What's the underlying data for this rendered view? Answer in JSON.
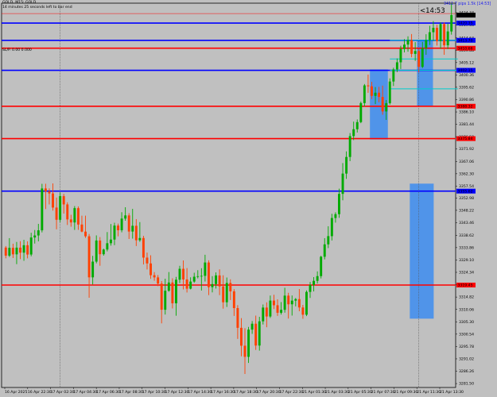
{
  "header": {
    "symbol_line": "GOLD, M15: GOLD",
    "info_line": "14 minutes 25 seconds left to bar end",
    "subinfo_line": "SL/P. 0.00 0.000"
  },
  "chart_data": {
    "type": "candlestick",
    "symbol": "GOLD",
    "timeframe": "M15",
    "ylim": [
      3280.0,
      3428.0
    ],
    "y_ticks": [
      3424.34,
      3419.58,
      3414.64,
      3409.88,
      3405.12,
      3400.36,
      3395.62,
      3390.86,
      3386.1,
      3381.44,
      3376.58,
      3371.92,
      3367.06,
      3362.3,
      3357.54,
      3352.98,
      3348.22,
      3343.46,
      3338.62,
      3333.86,
      3329.1,
      3324.34,
      3319.68,
      3314.82,
      3310.06,
      3305.3,
      3300.54,
      3295.78,
      3291.02,
      3286.26,
      3281.5
    ],
    "x_ticks": [
      "16 Apr 2025",
      "16 Apr 22:30",
      "17 Apr 02:30",
      "17 Apr 04:30",
      "17 Apr 06:30",
      "17 Apr 08:30",
      "17 Apr 10:30",
      "17 Apr 12:30",
      "17 Apr 14:30",
      "17 Apr 16:30",
      "17 Apr 18:30",
      "17 Apr 20:30",
      "17 Apr 22:30",
      "21 Apr 01:30",
      "21 Apr 03:30",
      "21 Apr 05:30",
      "21 Apr 07:30",
      "21 Apr 09:30",
      "21 Apr 11:30",
      "21 Apr 13:30"
    ],
    "session_separators": [
      "16 Apr 22:30",
      "21 Apr 01:00"
    ],
    "current_price": 3423.4,
    "bar_countdown": "<14:53",
    "chart_label": "3411.7 pips 1.5k [14:53]",
    "blue_levels": [
      3420.35,
      3413.7,
      3402.15,
      3355.62
    ],
    "red_levels": [
      3410.66,
      3388.32,
      3375.84,
      3319.45
    ],
    "candles_ohlc": [
      [
        3333.88,
        3334.46,
        3329.73,
        3330.77
      ],
      [
        3330.77,
        3337.51,
        3330.22,
        3333.78
      ],
      [
        3333.78,
        3335.37,
        3329.86,
        3331.27
      ],
      [
        3331.27,
        3336.05,
        3327.5,
        3333.85
      ],
      [
        3333.85,
        3336.34,
        3329.42,
        3331.92
      ],
      [
        3331.92,
        3336.87,
        3328.77,
        3334.78
      ],
      [
        3334.78,
        3336.29,
        3329.72,
        3331.2
      ],
      [
        3331.2,
        3339.59,
        3330.51,
        3337.76
      ],
      [
        3337.76,
        3340.65,
        3335.42,
        3338.54
      ],
      [
        3338.54,
        3343.01,
        3336.28,
        3340.52
      ],
      [
        3340.52,
        3358.43,
        3339.72,
        3356.64
      ],
      [
        3356.64,
        3358.45,
        3348.71,
        3355.51
      ],
      [
        3355.51,
        3356.67,
        3350.47,
        3354.72
      ],
      [
        3354.72,
        3358.58,
        3348.1,
        3349.29
      ],
      [
        3349.29,
        3353.14,
        3340.91,
        3344.58
      ],
      [
        3344.58,
        3355.07,
        3343.68,
        3353.68
      ],
      [
        3353.68,
        3354.54,
        3346.96,
        3350.5
      ],
      [
        3350.5,
        3351.33,
        3342.58,
        3344.72
      ],
      [
        3344.72,
        3346.51,
        3341.92,
        3343.55
      ],
      [
        3343.55,
        3349.86,
        3340.68,
        3349.06
      ],
      [
        3349.06,
        3349.73,
        3340.71,
        3342.75
      ],
      [
        3342.75,
        3346.17,
        3339.77,
        3340.02
      ],
      [
        3340.02,
        3346.16,
        3337.62,
        3338.23
      ],
      [
        3338.23,
        3339.11,
        3314.56,
        3322.41
      ],
      [
        3322.41,
        3330.69,
        3319.66,
        3328.47
      ],
      [
        3328.47,
        3338.57,
        3327.81,
        3336.6
      ],
      [
        3336.6,
        3337.91,
        3326.87,
        3331.32
      ],
      [
        3331.32,
        3333.46,
        3330.77,
        3333.12
      ],
      [
        3333.12,
        3339.85,
        3332.41,
        3335.55
      ],
      [
        3335.55,
        3342.93,
        3334.62,
        3336.96
      ],
      [
        3336.96,
        3343.46,
        3334.82,
        3342.35
      ],
      [
        3342.35,
        3343.11,
        3338.21,
        3340.55
      ],
      [
        3340.55,
        3347.5,
        3339.76,
        3345.05
      ],
      [
        3345.05,
        3349.42,
        3344.22,
        3346.26
      ],
      [
        3346.26,
        3347.14,
        3337.19,
        3340.05
      ],
      [
        3340.05,
        3348.79,
        3337.33,
        3342.27
      ],
      [
        3342.27,
        3344.84,
        3334.47,
        3336.69
      ],
      [
        3336.69,
        3343.69,
        3336.08,
        3337.56
      ],
      [
        3337.56,
        3338.41,
        3327.38,
        3330.01
      ],
      [
        3330.01,
        3331.95,
        3325.45,
        3327.77
      ],
      [
        3327.77,
        3330.93,
        3321.8,
        3323.24
      ],
      [
        3323.24,
        3324.42,
        3321.1,
        3322.39
      ],
      [
        3322.39,
        3323.3,
        3319.03,
        3320.0
      ],
      [
        3320.0,
        3320.98,
        3304.69,
        3309.94
      ],
      [
        3309.94,
        3321.89,
        3308.08,
        3317.25
      ],
      [
        3317.25,
        3324.45,
        3316.86,
        3320.42
      ],
      [
        3320.42,
        3322.05,
        3310.43,
        3312.41
      ],
      [
        3312.41,
        3322.59,
        3307.63,
        3321.51
      ],
      [
        3321.51,
        3326.88,
        3320.22,
        3325.7
      ],
      [
        3325.7,
        3328.92,
        3317.77,
        3321.6
      ],
      [
        3321.6,
        3325.99,
        3316.57,
        3318.05
      ],
      [
        3318.05,
        3322.42,
        3317.78,
        3320.78
      ],
      [
        3320.78,
        3324.19,
        3320.32,
        3322.66
      ],
      [
        3322.66,
        3325.17,
        3322.01,
        3322.84
      ],
      [
        3322.84,
        3325.93,
        3317.34,
        3322.98
      ],
      [
        3322.98,
        3331.11,
        3320.8,
        3328.13
      ],
      [
        3328.13,
        3328.97,
        3315.57,
        3318.62
      ],
      [
        3318.62,
        3322.9,
        3316.6,
        3319.82
      ],
      [
        3319.82,
        3324.32,
        3318.09,
        3323.16
      ],
      [
        3323.16,
        3325.49,
        3315.56,
        3318.92
      ],
      [
        3318.92,
        3323.22,
        3310.36,
        3312.82
      ],
      [
        3312.82,
        3322.35,
        3311.01,
        3320.25
      ],
      [
        3320.25,
        3321.65,
        3313.67,
        3317.03
      ],
      [
        3317.03,
        3317.88,
        3307.56,
        3310.57
      ],
      [
        3310.57,
        3311.71,
        3298.71,
        3302.97
      ],
      [
        3302.97,
        3306.71,
        3292.01,
        3296.08
      ],
      [
        3296.08,
        3302.81,
        3285.18,
        3291.8
      ],
      [
        3291.8,
        3303.32,
        3289.45,
        3302.28
      ],
      [
        3302.28,
        3305.58,
        3300.64,
        3304.55
      ],
      [
        3304.55,
        3307.68,
        3294.46,
        3296.14
      ],
      [
        3296.14,
        3307.2,
        3294.19,
        3305.48
      ],
      [
        3305.48,
        3311.96,
        3304.26,
        3310.78
      ],
      [
        3310.78,
        3312.78,
        3303.2,
        3307.34
      ],
      [
        3307.34,
        3315.4,
        3306.76,
        3313.46
      ],
      [
        3313.46,
        3315.71,
        3310.2,
        3311.67
      ],
      [
        3311.67,
        3313.95,
        3307.54,
        3308.77
      ],
      [
        3308.77,
        3312.89,
        3308.1,
        3309.91
      ],
      [
        3309.91,
        3318.4,
        3308.81,
        3315.37
      ],
      [
        3315.37,
        3316.46,
        3306.53,
        3312.03
      ],
      [
        3312.03,
        3315.43,
        3307.69,
        3313.45
      ],
      [
        3313.45,
        3314.46,
        3311.25,
        3314.03
      ],
      [
        3314.03,
        3317.92,
        3309.35,
        3310.81
      ],
      [
        3310.81,
        3311.8,
        3306.46,
        3308.02
      ],
      [
        3308.02,
        3317.38,
        3307.5,
        3316.81
      ],
      [
        3316.81,
        3320.64,
        3314.47,
        3319.5
      ],
      [
        3319.5,
        3322.51,
        3316.99,
        3321.06
      ],
      [
        3321.06,
        3324.71,
        3320.04,
        3322.89
      ],
      [
        3322.89,
        3330.74,
        3321.99,
        3330.35
      ],
      [
        3330.35,
        3337.5,
        3329.33,
        3335.12
      ],
      [
        3335.12,
        3342.09,
        3333.67,
        3338.28
      ],
      [
        3338.28,
        3346.9,
        3336.62,
        3345.26
      ],
      [
        3345.26,
        3347.47,
        3343.48,
        3346.74
      ],
      [
        3346.74,
        3356.57,
        3345.31,
        3354.57
      ],
      [
        3354.57,
        3366.44,
        3352.07,
        3362.37
      ],
      [
        3362.37,
        3370.93,
        3360.33,
        3368.77
      ],
      [
        3368.77,
        3377.97,
        3367.17,
        3376.81
      ],
      [
        3376.81,
        3382.39,
        3375.28,
        3379.45
      ],
      [
        3379.45,
        3383.22,
        3378.21,
        3382.2
      ],
      [
        3382.2,
        3390.1,
        3381.78,
        3389.52
      ],
      [
        3389.52,
        3396.87,
        3388.24,
        3396.34
      ],
      [
        3396.34,
        3400.5,
        3393.48,
        3395.99
      ],
      [
        3395.99,
        3397.74,
        3391.06,
        3392.3
      ],
      [
        3392.3,
        3395.71,
        3389.12,
        3393.52
      ],
      [
        3393.52,
        3395.78,
        3389.87,
        3391.89
      ],
      [
        3391.89,
        3396.25,
        3385.04,
        3386.31
      ],
      [
        3386.31,
        3390.7,
        3383.04,
        3389.5
      ],
      [
        3389.5,
        3399.05,
        3388.93,
        3397.83
      ],
      [
        3397.83,
        3403.14,
        3396.11,
        3402.5
      ],
      [
        3402.5,
        3406.72,
        3401.46,
        3405.23
      ],
      [
        3405.23,
        3411.61,
        3402.66,
        3410.34
      ],
      [
        3410.34,
        3414.15,
        3409.04,
        3412.06
      ],
      [
        3412.06,
        3415.23,
        3409.31,
        3413.75
      ],
      [
        3413.75,
        3416.12,
        3407.17,
        3408.47
      ],
      [
        3408.47,
        3412.99,
        3405.78,
        3409.58
      ],
      [
        3409.58,
        3410.44,
        3401.28,
        3403.48
      ],
      [
        3403.48,
        3413.08,
        3402.99,
        3410.66
      ],
      [
        3410.66,
        3416.04,
        3408.12,
        3413.74
      ],
      [
        3413.74,
        3419.29,
        3411.89,
        3416.82
      ],
      [
        3416.82,
        3421.08,
        3413.45,
        3418.5
      ],
      [
        3418.5,
        3419.68,
        3411.67,
        3413.41
      ],
      [
        3413.41,
        3420.64,
        3410.39,
        3419.96
      ],
      [
        3419.96,
        3420.58,
        3408.13,
        3411.78
      ],
      [
        3411.78,
        3420.12,
        3410.32,
        3417.11
      ],
      [
        3417.11,
        3427.8,
        3415.88,
        3423.4
      ]
    ]
  }
}
